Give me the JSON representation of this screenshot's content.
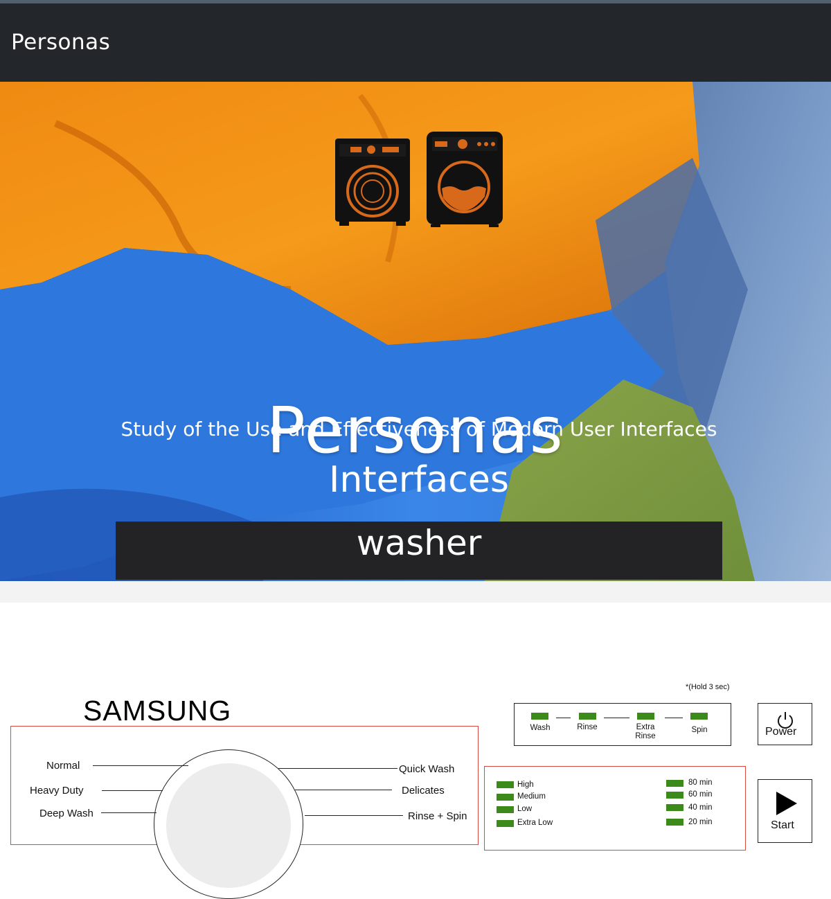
{
  "navbar": {
    "brand": "Personas"
  },
  "hero": {
    "title": "Personas",
    "subtitle": "Study of the Use and Effectiveness of Modern User Interfaces",
    "section_heading": "Interfaces",
    "active_tab": "washer"
  },
  "panel": {
    "brand": "SAMSUNG",
    "cycles_left": [
      "Normal",
      "Heavy Duty",
      "Deep Wash"
    ],
    "cycles_right": [
      "Quick Wash",
      "Delicates",
      "Rinse + Spin"
    ],
    "hold_note": "*(Hold 3 sec)",
    "stages": [
      {
        "label": "Wash"
      },
      {
        "label": "Rinse"
      },
      {
        "label": "Extra\nRinse"
      },
      {
        "label": "Spin"
      }
    ],
    "power_label": "Power",
    "start_label": "Start",
    "soil_levels": [
      "High",
      "Medium",
      "Low",
      "Extra Low"
    ],
    "times": [
      "80 min",
      "60 min",
      "40 min",
      "20 min"
    ],
    "colors": {
      "indicator": "#3b8a1a",
      "outline": "#d84a3e"
    }
  }
}
